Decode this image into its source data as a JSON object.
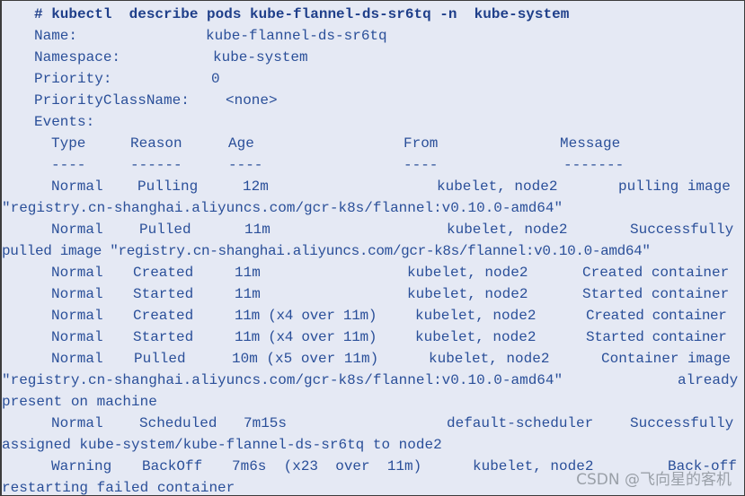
{
  "command": "# kubectl  describe pods kube-flannel-ds-sr6tq -n  kube-system",
  "fields": [
    {
      "label": "Name:",
      "value": "kube-flannel-ds-sr6tq"
    },
    {
      "label": "Namespace:",
      "value": "kube-system"
    },
    {
      "label": "Priority:",
      "value": "0"
    },
    {
      "label": "PriorityClassName:",
      "value": "<none>"
    }
  ],
  "events_label": "Events:",
  "columns": [
    "Type",
    "Reason",
    "Age",
    "From",
    "Message"
  ],
  "underlines": [
    "----",
    "------",
    "----",
    "----",
    "-------"
  ],
  "events": [
    {
      "type": "Normal",
      "reason": "Pulling",
      "age": "12m",
      "from": "kubelet, node2",
      "message_head": "pulling image",
      "message_cont": "\"registry.cn-shanghai.aliyuncs.com/gcr-k8s/flannel:v0.10.0-amd64\""
    },
    {
      "type": "Normal",
      "reason": "Pulled",
      "age": "11m",
      "from": "kubelet, node2",
      "message_head": "Successfully",
      "message_cont": "pulled image \"registry.cn-shanghai.aliyuncs.com/gcr-k8s/flannel:v0.10.0-amd64\""
    },
    {
      "type": "Normal",
      "reason": "Created",
      "age": "11m",
      "from": "kubelet, node2",
      "message_head": "Created container"
    },
    {
      "type": "Normal",
      "reason": "Started",
      "age": "11m",
      "from": "kubelet, node2",
      "message_head": "Started container"
    },
    {
      "type": "Normal",
      "reason": "Created",
      "age": "11m (x4 over 11m)",
      "from": "kubelet, node2",
      "message_head": "Created container"
    },
    {
      "type": "Normal",
      "reason": "Started",
      "age": "11m (x4 over 11m)",
      "from": "kubelet, node2",
      "message_head": "Started container"
    },
    {
      "type": "Normal",
      "reason": "Pulled",
      "age": "10m (x5 over 11m)",
      "from": "kubelet, node2",
      "message_head": "Container image",
      "message_cont": "\"registry.cn-shanghai.aliyuncs.com/gcr-k8s/flannel:v0.10.0-amd64\"",
      "message_cont_tail": "already",
      "message_cont2": "present on machine"
    },
    {
      "type": "Normal",
      "reason": "Scheduled",
      "age": "7m15s",
      "from": "default-scheduler",
      "message_head": "Successfully",
      "message_cont": "assigned kube-system/kube-flannel-ds-sr6tq to node2"
    },
    {
      "type": "Warning",
      "reason": "BackOff",
      "age": "7m6s  (x23  over  11m)",
      "from": "kubelet, node2",
      "message_head": "Back-off",
      "message_cont": "restarting failed container"
    }
  ],
  "watermark": "CSDN @飞向星的客机"
}
